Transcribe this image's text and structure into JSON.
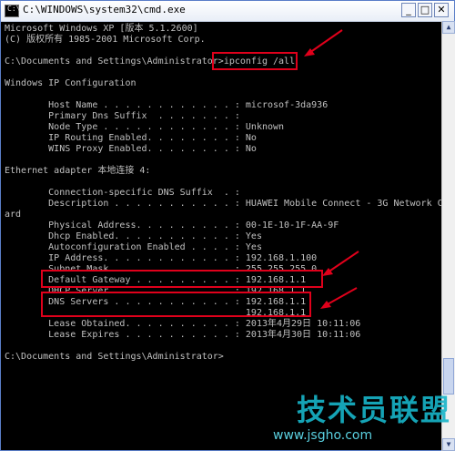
{
  "window": {
    "title": "C:\\WINDOWS\\system32\\cmd.exe",
    "icon_label": "C:\\"
  },
  "console": {
    "lines": [
      "Microsoft Windows XP [版本 5.1.2600]",
      "(C) 版权所有 1985-2001 Microsoft Corp.",
      "",
      "C:\\Documents and Settings\\Administrator>ipconfig /all",
      "",
      "Windows IP Configuration",
      "",
      "        Host Name . . . . . . . . . . . . : microsof-3da936",
      "        Primary Dns Suffix  . . . . . . . :",
      "        Node Type . . . . . . . . . . . . : Unknown",
      "        IP Routing Enabled. . . . . . . . : No",
      "        WINS Proxy Enabled. . . . . . . . : No",
      "",
      "Ethernet adapter 本地连接 4:",
      "",
      "        Connection-specific DNS Suffix  . :",
      "        Description . . . . . . . . . . . : HUAWEI Mobile Connect - 3G Network C",
      "ard",
      "        Physical Address. . . . . . . . . : 00-1E-10-1F-AA-9F",
      "        Dhcp Enabled. . . . . . . . . . . : Yes",
      "        Autoconfiguration Enabled . . . . : Yes",
      "        IP Address. . . . . . . . . . . . : 192.168.1.100",
      "        Subnet Mask . . . . . . . . . . . : 255.255.255.0",
      "        Default Gateway . . . . . . . . . : 192.168.1.1",
      "        DHCP Server . . . . . . . . . . . : 192.168.1.1",
      "        DNS Servers . . . . . . . . . . . : 192.168.1.1",
      "                                            192.168.1.1",
      "        Lease Obtained. . . . . . . . . . : 2013年4月29日 10:11:06",
      "        Lease Expires . . . . . . . . . . : 2013年4月30日 10:11:06",
      "",
      "C:\\Documents and Settings\\Administrator>"
    ]
  },
  "watermark": {
    "main": "技术员联盟",
    "sub": "www.jsgho.com"
  },
  "colors": {
    "console_bg": "#000000",
    "console_text": "#c0c0c0",
    "highlight": "#e0001b",
    "watermark": "#18b5c9"
  }
}
